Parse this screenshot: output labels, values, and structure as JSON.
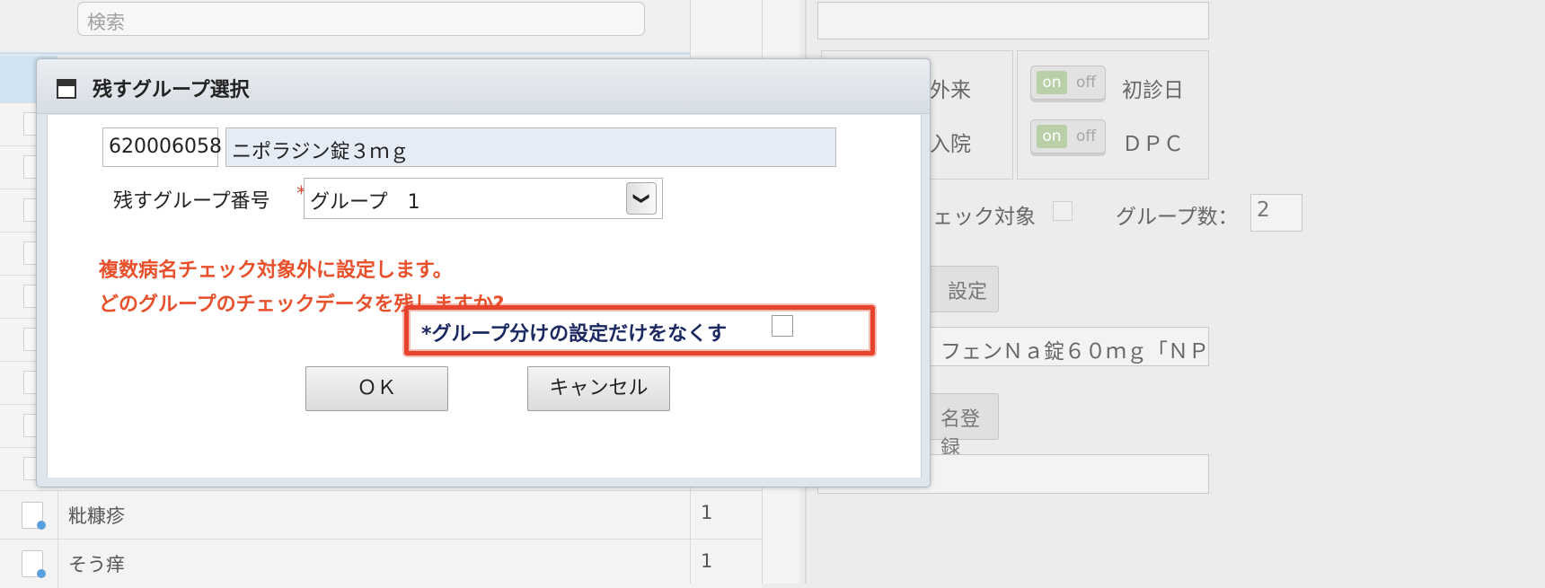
{
  "background": {
    "search_placeholder": "検索",
    "rows": [
      {
        "name": "粃糠疹",
        "count": "1"
      },
      {
        "name": "そう痒",
        "count": "1"
      }
    ],
    "right": {
      "gairai": "外来",
      "nyuin": "入院",
      "shoshinbi": "初診日",
      "dpc": "ＤＰＣ",
      "toggle_on": "on",
      "toggle_off": "off",
      "check_target": "ェック対象",
      "group_count_label": "グループ数：",
      "group_count_value": "2",
      "settei_btn": "設定",
      "drug_field": "フェンＮａ錠６０ｍｇ「ＮＰ",
      "register_btn": "名登録"
    }
  },
  "modal": {
    "title": "残すグループ選択",
    "code": "620006058",
    "drug_name": "ニポラジン錠３ｍｇ",
    "group_label": "残すグループ番号",
    "required_mark": "*",
    "group_selected": "グループ　1",
    "message_line1": "複数病名チェック対象外に設定します。",
    "message_line2": "どのグループのチェックデータを残しますか?",
    "only_grouping_label": "*グループ分けの設定だけをなくす",
    "ok_label": "ＯＫ",
    "cancel_label": "キャンセル",
    "highlight_color": "#e8432b"
  }
}
